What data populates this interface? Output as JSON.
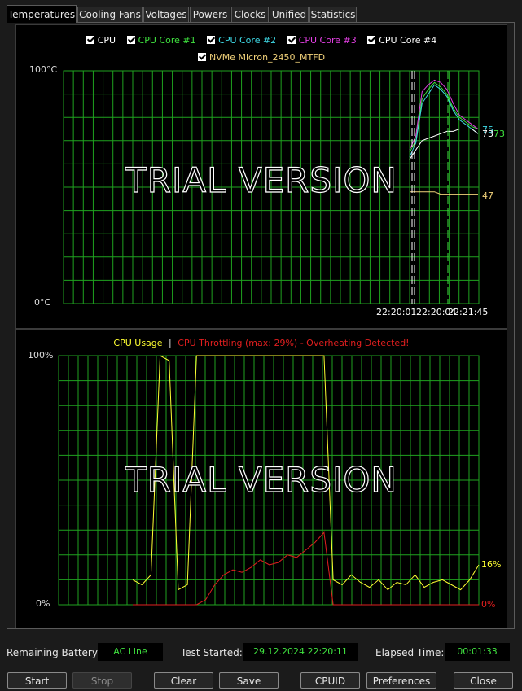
{
  "tabs": [
    {
      "label": "Temperatures",
      "active": true
    },
    {
      "label": "Cooling Fans"
    },
    {
      "label": "Voltages"
    },
    {
      "label": "Powers"
    },
    {
      "label": "Clocks"
    },
    {
      "label": "Unified"
    },
    {
      "label": "Statistics"
    }
  ],
  "temp_panel": {
    "legend_row1": [
      {
        "label": "CPU",
        "color": "#ffffff"
      },
      {
        "label": "CPU Core #1",
        "color": "#3fe23f"
      },
      {
        "label": "CPU Core #2",
        "color": "#3ed9e6"
      },
      {
        "label": "CPU Core #3",
        "color": "#e23fe2"
      },
      {
        "label": "CPU Core #4",
        "color": "#ffffff"
      }
    ],
    "legend_row2": [
      {
        "label": "NVMe Micron_2450_MTFD",
        "color": "#f2d27a"
      }
    ],
    "y_top": "100°C",
    "y_bottom": "0°C",
    "watermark": "TRIAL VERSION",
    "time_labels": [
      "22:20:01",
      "22:20:04",
      "22:21:45"
    ],
    "readout_a": "75",
    "readout_b": "73",
    "readout_c": "73",
    "readout_d": "47"
  },
  "usage_panel": {
    "legend_usage": "CPU Usage",
    "legend_sep": "|",
    "legend_throttle": "CPU Throttling (max: 29%) - Overheating Detected!",
    "y_top": "100%",
    "y_bottom": "0%",
    "watermark": "TRIAL VERSION",
    "readout_usage": "16%",
    "readout_throttle": "0%"
  },
  "colors": {
    "grid": "#1fa21f",
    "usage": "#ffff32",
    "throttle": "#e21f1f",
    "core1": "#3fe23f",
    "core2": "#3ed9e6",
    "core3": "#e23fe2",
    "cpu": "#ffffff",
    "nvme": "#f2d27a",
    "value_text": "#3fe23f"
  },
  "chart_data": [
    {
      "type": "line",
      "yunit": "°C",
      "ylim": [
        0,
        100
      ],
      "x_tick_labels": [
        "22:20:01",
        "22:20:04",
        "22:21:45"
      ],
      "grid": true,
      "legend_position": "top-center",
      "series": [
        {
          "name": "CPU Core #1",
          "values": [
            65,
            70,
            88,
            92,
            95,
            93,
            90,
            84,
            80,
            78,
            76,
            75
          ]
        },
        {
          "name": "CPU Core #2",
          "values": [
            63,
            69,
            86,
            90,
            94,
            92,
            89,
            83,
            79,
            77,
            75,
            73
          ]
        },
        {
          "name": "CPU Core #3",
          "values": [
            66,
            72,
            91,
            94,
            96,
            95,
            92,
            86,
            81,
            79,
            77,
            75
          ]
        },
        {
          "name": "CPU Core #4",
          "values": [
            62,
            66,
            70,
            71,
            72,
            73,
            74,
            74,
            75,
            75,
            75,
            73
          ]
        },
        {
          "name": "NVMe Micron_2450_MTFD",
          "values": [
            48,
            48,
            48,
            48,
            48,
            47,
            47,
            47,
            47,
            47,
            47,
            47
          ]
        }
      ]
    },
    {
      "type": "line",
      "yunit": "%",
      "ylim": [
        0,
        100
      ],
      "grid": true,
      "legend_position": "top-center",
      "series": [
        {
          "name": "CPU Usage",
          "values": [
            10,
            8,
            12,
            100,
            98,
            6,
            8,
            100,
            100,
            100,
            100,
            100,
            100,
            100,
            100,
            100,
            100,
            100,
            100,
            100,
            100,
            100,
            10,
            8,
            12,
            9,
            7,
            10,
            6,
            9,
            8,
            12,
            7,
            9,
            10,
            8,
            6,
            10,
            16
          ]
        },
        {
          "name": "CPU Throttling",
          "values": [
            0,
            0,
            0,
            0,
            0,
            0,
            0,
            0,
            2,
            8,
            12,
            14,
            13,
            15,
            18,
            16,
            17,
            20,
            19,
            22,
            25,
            29,
            0,
            0,
            0,
            0,
            0,
            0,
            0,
            0,
            0,
            0,
            0,
            0,
            0,
            0,
            0,
            0,
            0
          ]
        }
      ]
    }
  ],
  "status": {
    "battery_label": "Remaining Battery:",
    "battery_value": "AC Line",
    "started_label": "Test Started:",
    "started_value": "29.12.2024 22:20:11",
    "elapsed_label": "Elapsed Time:",
    "elapsed_value": "00:01:33"
  },
  "buttons": {
    "start": "Start",
    "stop": "Stop",
    "clear": "Clear",
    "save": "Save",
    "cpuid": "CPUID",
    "preferences": "Preferences",
    "close": "Close"
  }
}
